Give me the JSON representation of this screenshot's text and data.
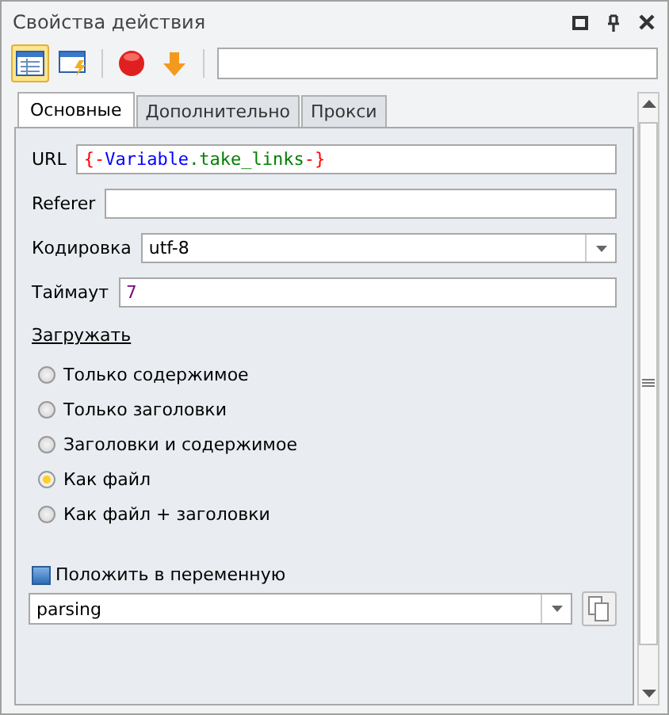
{
  "window": {
    "title": "Свойства действия"
  },
  "toolbar": {
    "buttons": [
      {
        "kind": "table",
        "selected": true
      },
      {
        "kind": "window",
        "selected": false
      },
      {
        "kind": "stop",
        "selected": false
      },
      {
        "kind": "down",
        "selected": false
      }
    ]
  },
  "tabs": [
    {
      "label": "Основные",
      "selected": true
    },
    {
      "label": "Дополнительно",
      "selected": false
    },
    {
      "label": "Прокси",
      "selected": false
    }
  ],
  "fields": [
    {
      "kind": "text",
      "label": "URL",
      "segments": [
        {
          "text": "{-",
          "color": "#ff0000"
        },
        {
          "text": "Variable",
          "color": "#0000ff"
        },
        {
          "text": ".take_links",
          "color": "#008000"
        },
        {
          "text": "-}",
          "color": "#ff0000"
        }
      ]
    },
    {
      "kind": "text",
      "label": "Referer"
    },
    {
      "kind": "select",
      "label": "Кодировка",
      "value": "utf-8"
    },
    {
      "kind": "text",
      "label": "Таймаут",
      "segments": [
        {
          "text": "7",
          "color": "#800080"
        }
      ]
    }
  ],
  "download": {
    "label": "Загружать",
    "options": [
      {
        "label": "Только содержимое",
        "selected": false
      },
      {
        "label": "Только заголовки",
        "selected": false
      },
      {
        "label": "Заголовки и содержимое",
        "selected": false
      },
      {
        "label": "Как файл",
        "selected": true
      },
      {
        "label": "Как файл + заголовки",
        "selected": false
      }
    ]
  },
  "save_to_variable": {
    "label": "Положить в переменную",
    "value": "parsing"
  }
}
